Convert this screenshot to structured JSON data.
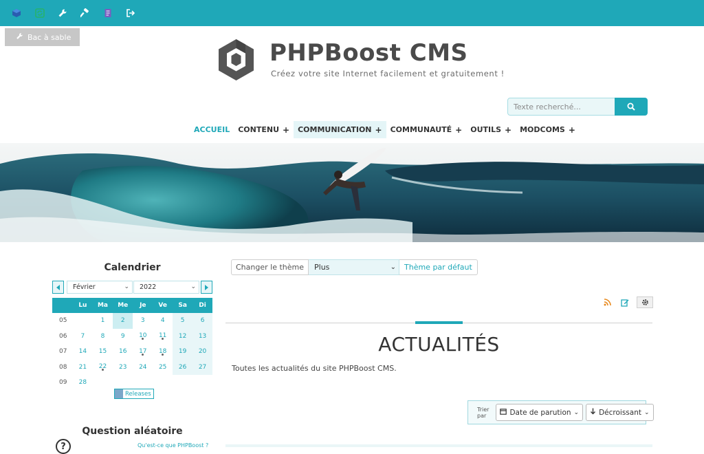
{
  "topbar": {
    "icons": [
      "cube-icon",
      "refresh-icon",
      "wrench-icon",
      "hammer-icon",
      "notepad-icon",
      "logout-icon"
    ],
    "bg_color": "#1fa8b8"
  },
  "sandbox": {
    "label": "Bac à sable"
  },
  "header": {
    "title": "PHPBoost CMS",
    "slogan": "Créez votre site Internet facilement et gratuitement !"
  },
  "search": {
    "placeholder": "Texte recherché..."
  },
  "nav": {
    "items": [
      {
        "label": "ACCUEIL",
        "plus": ""
      },
      {
        "label": "CONTENU",
        "plus": "+"
      },
      {
        "label": "COMMUNICATION",
        "plus": "+"
      },
      {
        "label": "COMMUNAUTÉ",
        "plus": "+"
      },
      {
        "label": "OUTILS",
        "plus": "+"
      },
      {
        "label": "MODCOMS",
        "plus": "+"
      }
    ]
  },
  "calendar": {
    "title": "Calendrier",
    "month": "Février",
    "year": "2022",
    "headers": [
      "Lu",
      "Ma",
      "Me",
      "Je",
      "Ve",
      "Sa",
      "Di"
    ],
    "weeks": [
      {
        "wk": "05",
        "days": [
          "",
          "1",
          "2",
          "3",
          "4",
          "5",
          "6"
        ]
      },
      {
        "wk": "06",
        "days": [
          "7",
          "8",
          "9",
          "10",
          "11",
          "12",
          "13"
        ]
      },
      {
        "wk": "07",
        "days": [
          "14",
          "15",
          "16",
          "17",
          "18",
          "19",
          "20"
        ]
      },
      {
        "wk": "08",
        "days": [
          "21",
          "22",
          "23",
          "24",
          "25",
          "26",
          "27"
        ]
      },
      {
        "wk": "09",
        "days": [
          "28",
          "",
          "",
          "",
          "",
          "",
          ""
        ]
      }
    ],
    "legend": "Releases"
  },
  "question": {
    "title": "Question aléatoire",
    "link": "Qu'est-ce que PHPBoost ?"
  },
  "theme": {
    "label": "Changer le thème",
    "selected": "Plus",
    "default": "Thème par défaut"
  },
  "section": {
    "title": "ACTUALITÉS",
    "description": "Toutes les actualités du site PHPBoost CMS."
  },
  "sort": {
    "label": "Trier par",
    "field": "Date de parution",
    "order": "Décroissant"
  },
  "colors": {
    "accent": "#1fa8b8",
    "rss": "#e8891d"
  }
}
